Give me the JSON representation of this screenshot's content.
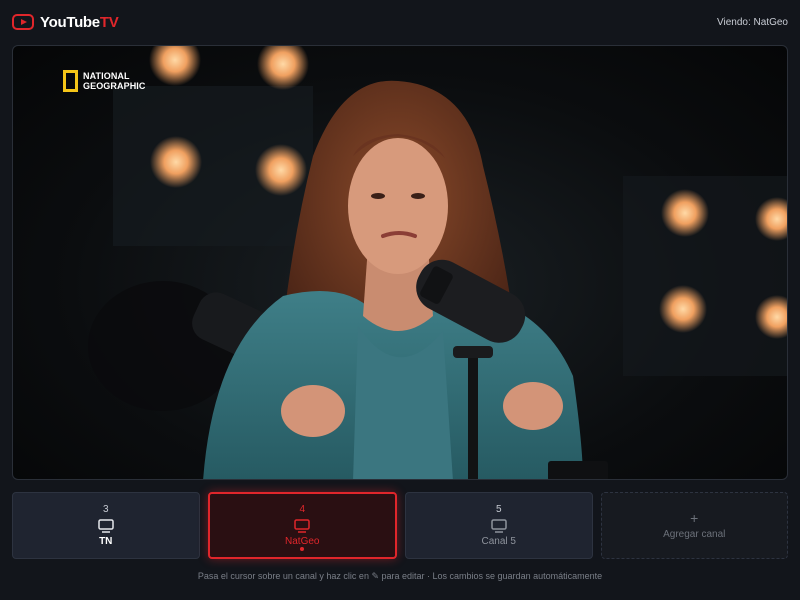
{
  "app": {
    "logo_main": "YouTube",
    "logo_tv": "TV",
    "viewing_label": "Viendo: NatGeo"
  },
  "player": {
    "brand_text_line1": "NATIONAL",
    "brand_text_line2": "GEOGRAPHIC"
  },
  "channels": [
    {
      "number": "3",
      "name": "TN",
      "state": "normal"
    },
    {
      "number": "4",
      "name": "NatGeo",
      "state": "active"
    },
    {
      "number": "5",
      "name": "Canal 5",
      "state": "dim"
    }
  ],
  "add_channel": {
    "plus": "+",
    "label": "Agregar canal"
  },
  "hint_text": "Pasa el cursor sobre un canal y haz clic en ✎ para editar · Los cambios se guardan automáticamente",
  "colors": {
    "accent": "#e0262b",
    "background": "#12151b",
    "tile": "#1f2430",
    "brand_frame": "#f5c518"
  }
}
